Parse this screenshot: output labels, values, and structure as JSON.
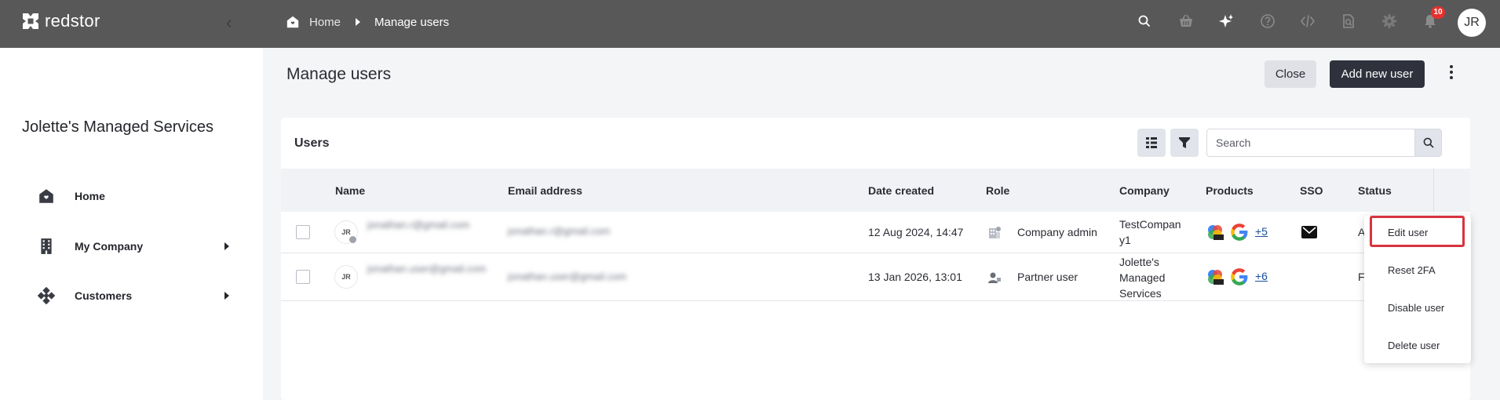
{
  "app": {
    "name": "redstor"
  },
  "breadcrumb": {
    "home": "Home",
    "current": "Manage users"
  },
  "topbar": {
    "icons": [
      "search-icon",
      "basket-icon",
      "sparkle-icon",
      "help-icon",
      "code-icon",
      "document-search-icon",
      "settings-icon",
      "bell-icon"
    ],
    "notification_count": "10",
    "avatar_initials": "JR"
  },
  "sidebar": {
    "company": "Jolette's Managed Services",
    "items": [
      {
        "label": "Home",
        "icon": "home-icon"
      },
      {
        "label": "My Company",
        "icon": "building-icon"
      },
      {
        "label": "Customers",
        "icon": "customers-icon"
      }
    ]
  },
  "page": {
    "title": "Manage users",
    "close_label": "Close",
    "add_label": "Add new user"
  },
  "users_card": {
    "title": "Users",
    "search_placeholder": "Search",
    "columns": [
      "Name",
      "Email address",
      "Date created",
      "Role",
      "Company",
      "Products",
      "SSO",
      "Status"
    ],
    "rows": [
      {
        "initials": "JR",
        "name": "jonathan.r@gmail.com",
        "email": "jonathan.r@gmail.com",
        "date": "12 Aug 2024, 14:47",
        "role": "Company admin",
        "company": "TestCompany1",
        "products_more": "+5",
        "sso": true,
        "status": "A"
      },
      {
        "initials": "JR",
        "name": "jonathan.user@gmail.com",
        "email": "jonathan.user@gmail.com",
        "date": "13 Jan 2026, 13:01",
        "role": "Partner user",
        "company": "Jolette's Managed Services",
        "products_more": "+6",
        "sso": false,
        "status": "F"
      }
    ]
  },
  "context_menu": {
    "items": [
      "Edit user",
      "Reset 2FA",
      "Disable user",
      "Delete user"
    ]
  },
  "colors": {
    "topbar": "#585858",
    "primary_button": "#2f323d",
    "highlight": "#d8333f",
    "link": "#1a4fa0"
  }
}
